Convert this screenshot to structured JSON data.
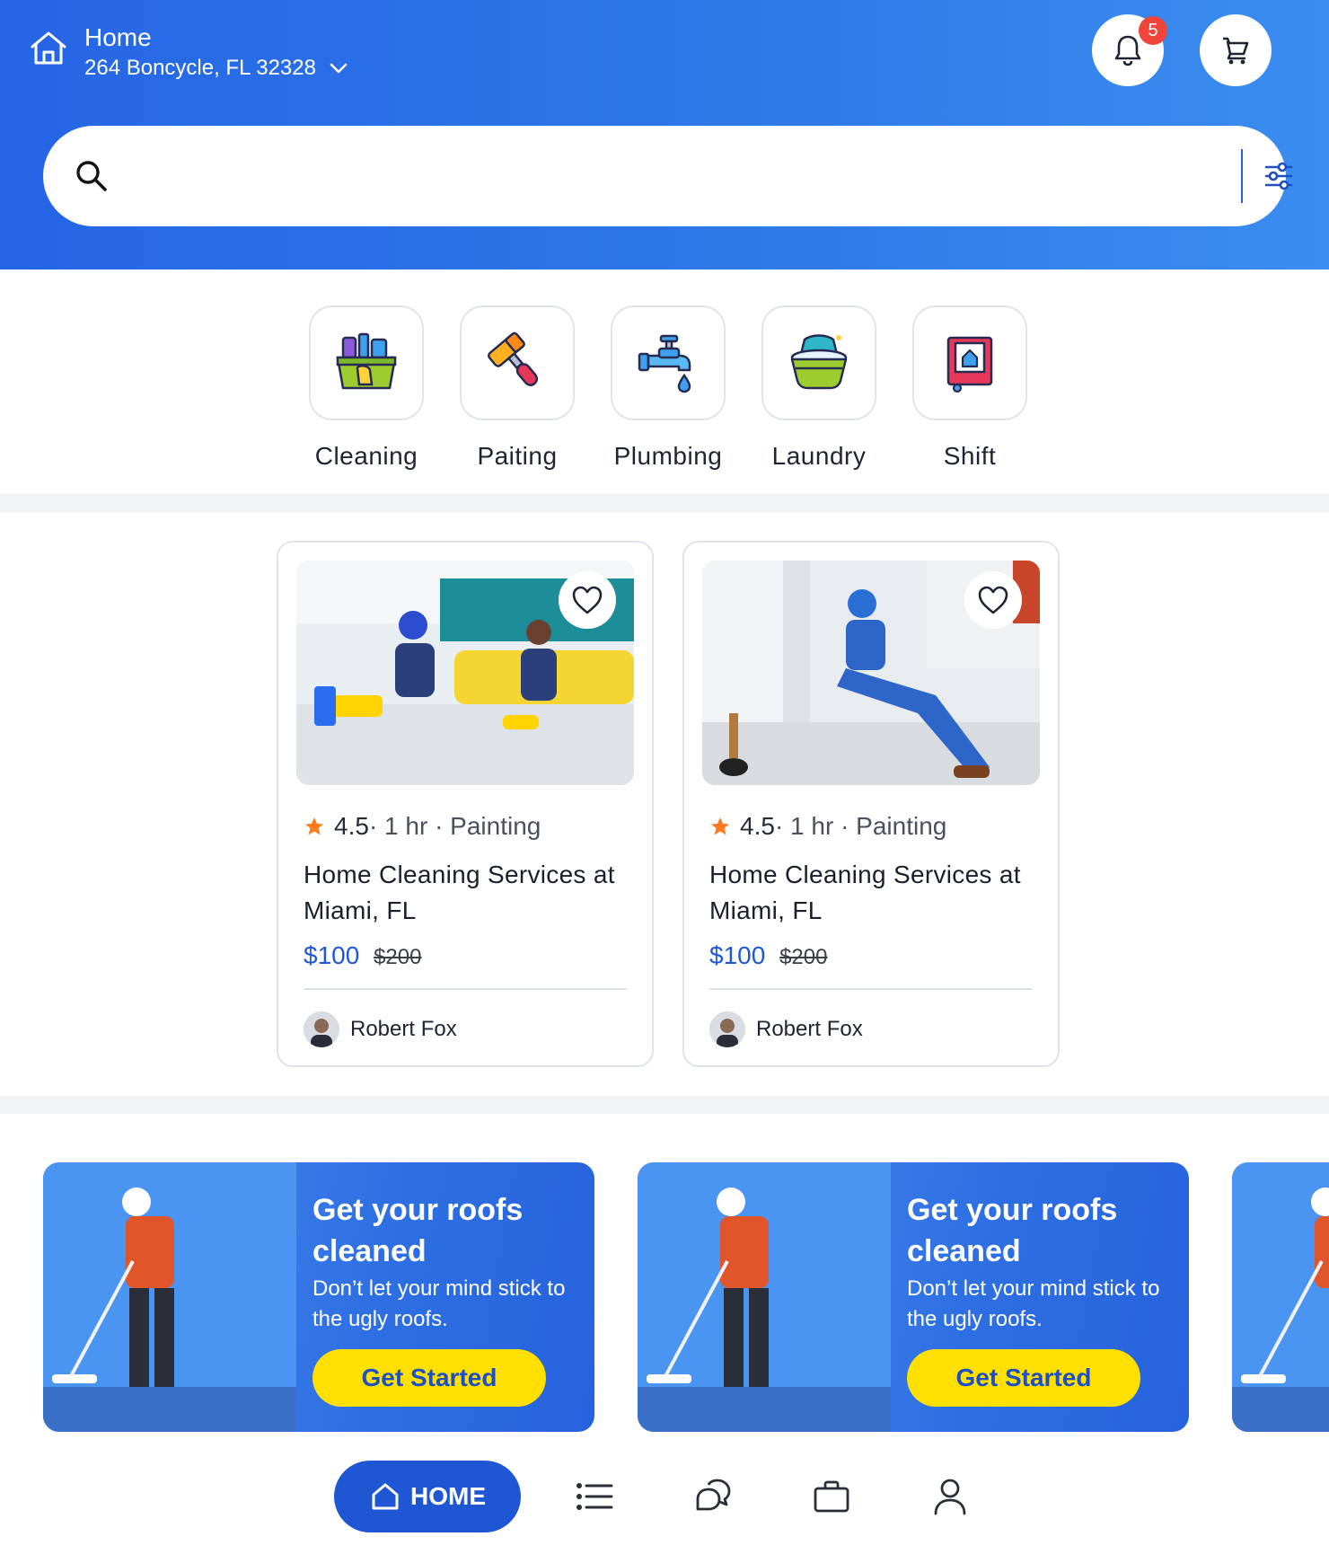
{
  "header": {
    "location_title": "Home",
    "address": "264 Boncycle, FL 32328",
    "notification_count": "5",
    "colors": {
      "gradient_start": "#2565e6",
      "gradient_end": "#3b8df0"
    }
  },
  "search": {
    "placeholder": "",
    "value": ""
  },
  "categories": [
    {
      "label": "Cleaning",
      "icon": "cleaning-basket-icon"
    },
    {
      "label": "Paiting",
      "icon": "paint-roller-icon"
    },
    {
      "label": "Plumbing",
      "icon": "faucet-icon"
    },
    {
      "label": "Laundry",
      "icon": "laundry-basin-icon"
    },
    {
      "label": "Shift",
      "icon": "moving-box-icon"
    }
  ],
  "services": [
    {
      "rating": "4.5",
      "meta": " · 1 hr · Painting",
      "title": "Home Cleaning Services at Miami, FL",
      "price": "$100",
      "old_price": "$200",
      "author": "Robert Fox"
    },
    {
      "rating": "4.5",
      "meta": " · 1 hr · Painting",
      "title": "Home Cleaning Services at Miami, FL",
      "price": "$100",
      "old_price": "$200",
      "author": "Robert Fox"
    }
  ],
  "promos": [
    {
      "title": "Get your roofs cleaned",
      "description": "Don’t let your mind stick to the ugly roofs.",
      "button": "Get Started"
    },
    {
      "title": "Get your roofs cleaned",
      "description": "Don’t let your mind stick to the ugly roofs.",
      "button": "Get Started"
    }
  ],
  "bottom_nav": {
    "home_label": "HOME",
    "items": [
      "list-icon",
      "chat-icon",
      "briefcase-icon",
      "profile-icon"
    ],
    "accent": "#1f56d4"
  }
}
